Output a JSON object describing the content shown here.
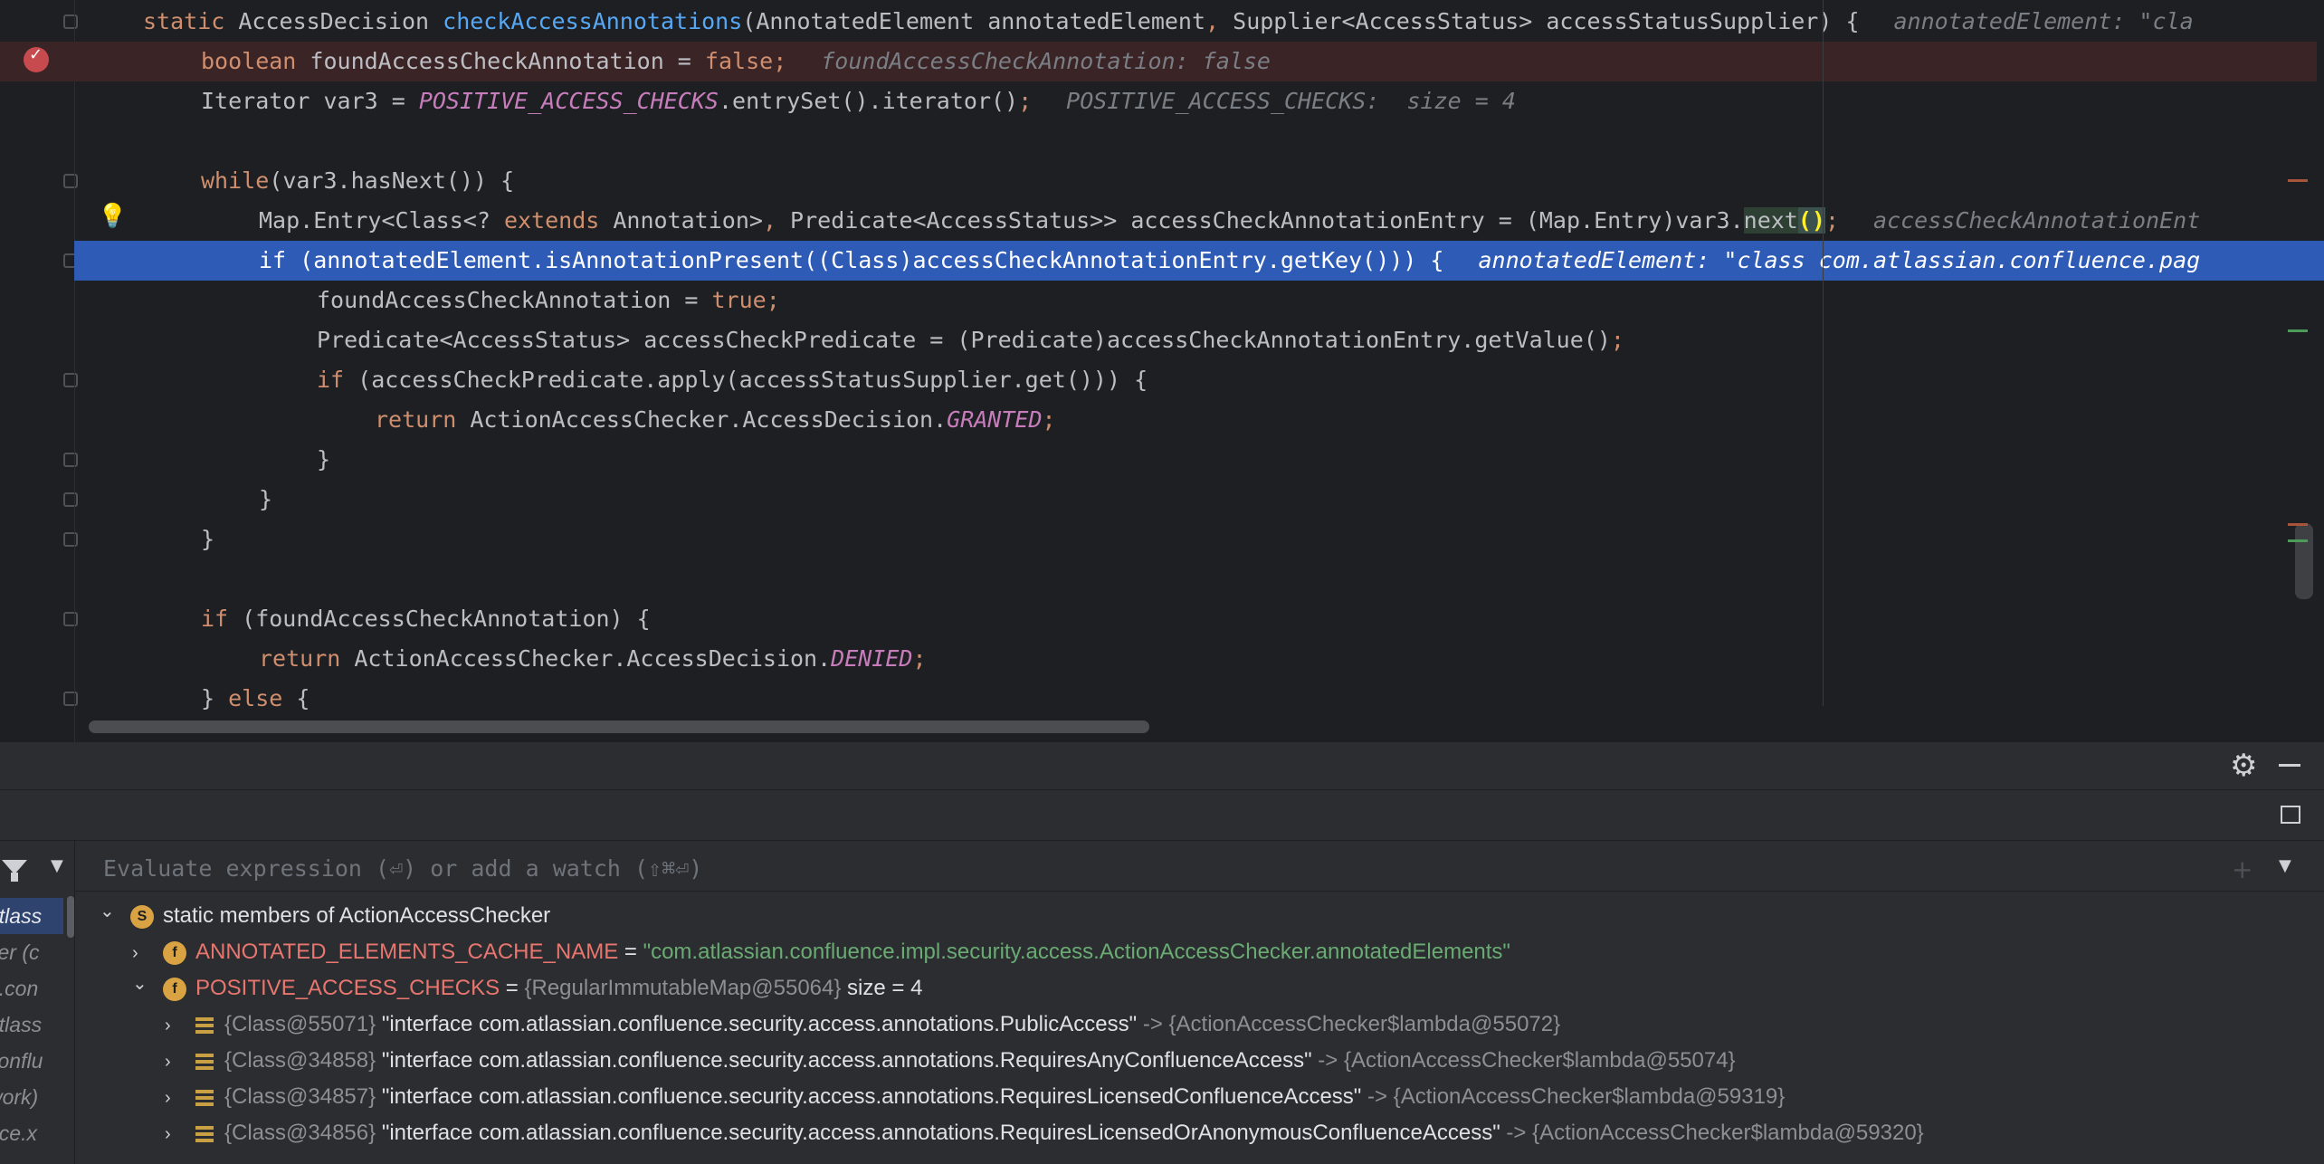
{
  "editor": {
    "lines": [
      {
        "tokens": [
          {
            "c": "kw",
            "t": "static "
          },
          {
            "c": "plain",
            "t": "AccessDecision "
          },
          {
            "c": "fn-decl",
            "t": "checkAccessAnnotations"
          },
          {
            "c": "plain",
            "t": "(AnnotatedElement annotatedElement"
          },
          {
            "c": "kw",
            "t": ", "
          },
          {
            "c": "plain",
            "t": "Supplier<AccessStatus> accessStatusSupplier) {"
          }
        ],
        "hint": "annotatedElement: \"cla"
      },
      {
        "tokens": [
          {
            "c": "kw",
            "t": "boolean "
          },
          {
            "c": "plain",
            "t": "foundAccessCheckAnnotation = "
          },
          {
            "c": "kw",
            "t": "false"
          },
          {
            "c": "kw",
            "t": ";"
          }
        ],
        "hint": "foundAccessCheckAnnotation: false"
      },
      {
        "tokens": [
          {
            "c": "plain",
            "t": "Iterator var3 = "
          },
          {
            "c": "const",
            "t": "POSITIVE_ACCESS_CHECKS"
          },
          {
            "c": "plain",
            "t": ".entrySet().iterator()"
          },
          {
            "c": "kw",
            "t": ";"
          }
        ],
        "hint": "POSITIVE_ACCESS_CHECKS:  size = 4"
      },
      {
        "tokens": [],
        "hint": ""
      },
      {
        "tokens": [
          {
            "c": "kw",
            "t": "while"
          },
          {
            "c": "plain",
            "t": "(var3.hasNext()) {"
          }
        ],
        "hint": ""
      },
      {
        "tokens": [
          {
            "c": "plain",
            "t": "Map.Entry<Class<? "
          },
          {
            "c": "kw",
            "t": "extends "
          },
          {
            "c": "plain",
            "t": "Annotation>"
          },
          {
            "c": "kw",
            "t": ", "
          },
          {
            "c": "plain",
            "t": "Predicate<AccessStatus>> accessCheckAnnotationEntry = (Map.Entry)var3."
          },
          {
            "c": "nxt-hl",
            "t": "next"
          },
          {
            "c": "paren-hl",
            "t": "()"
          },
          {
            "c": "kw",
            "t": ";"
          }
        ],
        "hint": "accessCheckAnnotationEnt"
      },
      {
        "tokens": [
          {
            "c": "kw",
            "t": "if "
          },
          {
            "c": "plain",
            "t": "(annotatedElement.isAnnotationPresent((Class)accessCheckAnnotationEntry.getKey())) {"
          }
        ],
        "hint": "annotatedElement: \"class com.atlassian.confluence.pag"
      },
      {
        "tokens": [
          {
            "c": "plain",
            "t": "foundAccessCheckAnnotation = "
          },
          {
            "c": "kw",
            "t": "true;"
          }
        ],
        "hint": ""
      },
      {
        "tokens": [
          {
            "c": "plain",
            "t": "Predicate<AccessStatus> accessCheckPredicate = (Predicate)accessCheckAnnotationEntry.getValue()"
          },
          {
            "c": "kw",
            "t": ";"
          }
        ],
        "hint": ""
      },
      {
        "tokens": [
          {
            "c": "kw",
            "t": "if "
          },
          {
            "c": "plain",
            "t": "(accessCheckPredicate.apply(accessStatusSupplier.get())) {"
          }
        ],
        "hint": ""
      },
      {
        "tokens": [
          {
            "c": "kw",
            "t": "return "
          },
          {
            "c": "plain",
            "t": "ActionAccessChecker.AccessDecision."
          },
          {
            "c": "const",
            "t": "GRANTED"
          },
          {
            "c": "kw",
            "t": ";"
          }
        ],
        "hint": ""
      },
      {
        "tokens": [
          {
            "c": "plain",
            "t": "}"
          }
        ],
        "hint": ""
      },
      {
        "tokens": [
          {
            "c": "plain",
            "t": "}"
          }
        ],
        "hint": ""
      },
      {
        "tokens": [
          {
            "c": "plain",
            "t": "}"
          }
        ],
        "hint": ""
      },
      {
        "tokens": [],
        "hint": ""
      },
      {
        "tokens": [
          {
            "c": "kw",
            "t": "if "
          },
          {
            "c": "plain",
            "t": "(foundAccessCheckAnnotation) {"
          }
        ],
        "hint": ""
      },
      {
        "tokens": [
          {
            "c": "kw",
            "t": "return "
          },
          {
            "c": "plain",
            "t": "ActionAccessChecker.AccessDecision."
          },
          {
            "c": "const",
            "t": "DENIED"
          },
          {
            "c": "kw",
            "t": ";"
          }
        ],
        "hint": ""
      },
      {
        "tokens": [
          {
            "c": "plain",
            "t": "} "
          },
          {
            "c": "kw",
            "t": "else "
          },
          {
            "c": "plain",
            "t": "{"
          }
        ],
        "hint": ""
      }
    ]
  },
  "debugger": {
    "eval_placeholder": "Evaluate expression (⏎) or add a watch (⇧⌘⏎)",
    "frames": [
      "atlass",
      "ker (c",
      "n.con",
      "atlass",
      "conflu",
      "work)",
      "nce.x"
    ],
    "variables": [
      {
        "level": 0,
        "expanded": true,
        "icon": "S",
        "kind": "static",
        "label_kw": "static",
        "label": " members of ActionAccessChecker"
      },
      {
        "level": 1,
        "expanded": false,
        "icon": "f",
        "kind": "field",
        "name": "ANNOTATED_ELEMENTS_CACHE_NAME",
        "eq": " = ",
        "value": "\"com.atlassian.confluence.impl.security.access.ActionAccessChecker.annotatedElements\"",
        "value_kind": "str"
      },
      {
        "level": 1,
        "expanded": true,
        "icon": "f",
        "kind": "field",
        "name": "POSITIVE_ACCESS_CHECKS",
        "eq": " = ",
        "value": "{RegularImmutableMap@55064}",
        "value_kind": "id",
        "extra": "  size = 4"
      },
      {
        "level": 2,
        "expanded": false,
        "icon": "=",
        "kind": "entry",
        "key_id": "{Class@55071} ",
        "key": "\"interface com.atlassian.confluence.security.access.annotations.PublicAccess\"",
        "arrow": " -> ",
        "val": "{ActionAccessChecker$lambda@55072}"
      },
      {
        "level": 2,
        "expanded": false,
        "icon": "=",
        "kind": "entry",
        "key_id": "{Class@34858} ",
        "key": "\"interface com.atlassian.confluence.security.access.annotations.RequiresAnyConfluenceAccess\"",
        "arrow": " -> ",
        "val": "{ActionAccessChecker$lambda@55074}"
      },
      {
        "level": 2,
        "expanded": false,
        "icon": "=",
        "kind": "entry",
        "key_id": "{Class@34857} ",
        "key": "\"interface com.atlassian.confluence.security.access.annotations.RequiresLicensedConfluenceAccess\"",
        "arrow": " -> ",
        "val": "{ActionAccessChecker$lambda@59319}"
      },
      {
        "level": 2,
        "expanded": false,
        "icon": "=",
        "kind": "entry",
        "key_id": "{Class@34856} ",
        "key": "\"interface com.atlassian.confluence.security.access.annotations.RequiresLicensedOrAnonymousConfluenceAccess\"",
        "arrow": " -> ",
        "val": "{ActionAccessChecker$lambda@59320}"
      }
    ]
  },
  "colors": {
    "editor_bg": "#1e1f22",
    "panel_bg": "#2b2d30",
    "exec_line": "#2e5bb5",
    "breakpoint": "#c74a4e",
    "keyword": "#cf8e6d",
    "function": "#56a8f5",
    "constant": "#c77dbb",
    "string": "#6aab73",
    "var_name": "#e8766f"
  },
  "icons": {
    "breakpoint": "breakpoint-icon",
    "intention": "lightbulb-icon",
    "settings": "gear-icon",
    "minimize": "minimize-icon",
    "layout": "layout-icon",
    "filter": "filter-icon",
    "add_watch": "add-watch-icon"
  }
}
